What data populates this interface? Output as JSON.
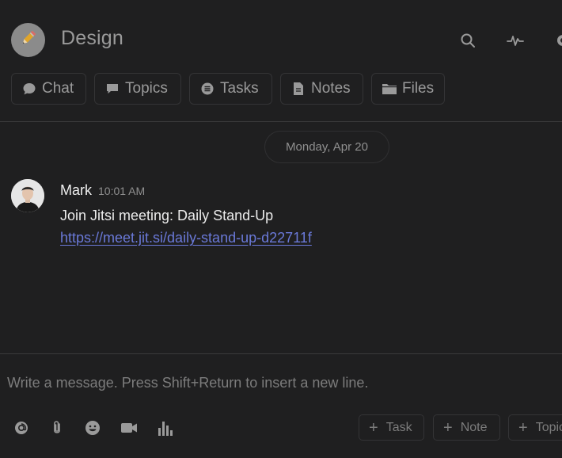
{
  "channel": {
    "title": "Design",
    "icon": "pencil-icon"
  },
  "header_actions": [
    "search-icon",
    "activity-icon",
    "gear-icon"
  ],
  "tabs": [
    {
      "label": "Chat",
      "icon": "chat-bubble-icon"
    },
    {
      "label": "Topics",
      "icon": "topics-icon"
    },
    {
      "label": "Tasks",
      "icon": "tasks-icon"
    },
    {
      "label": "Notes",
      "icon": "note-icon"
    },
    {
      "label": "Files",
      "icon": "folder-icon"
    }
  ],
  "date_divider": "Monday, Apr 20",
  "message": {
    "author": "Mark",
    "time": "10:01 AM",
    "text": "Join Jitsi meeting: Daily Stand-Up",
    "link": "https://meet.jit.si/daily-stand-up-d22711f"
  },
  "composer": {
    "placeholder": "Write a message. Press Shift+Return to insert a new line."
  },
  "toolbar": [
    "mention-icon",
    "attachment-icon",
    "emoji-icon",
    "video-icon",
    "poll-icon"
  ],
  "add_buttons": [
    {
      "label": "Task"
    },
    {
      "label": "Note"
    },
    {
      "label": "Topic"
    }
  ],
  "colors": {
    "background": "#1f1f20",
    "border": "#343436",
    "link": "#6a79d8",
    "muted": "#9a9a9a"
  }
}
